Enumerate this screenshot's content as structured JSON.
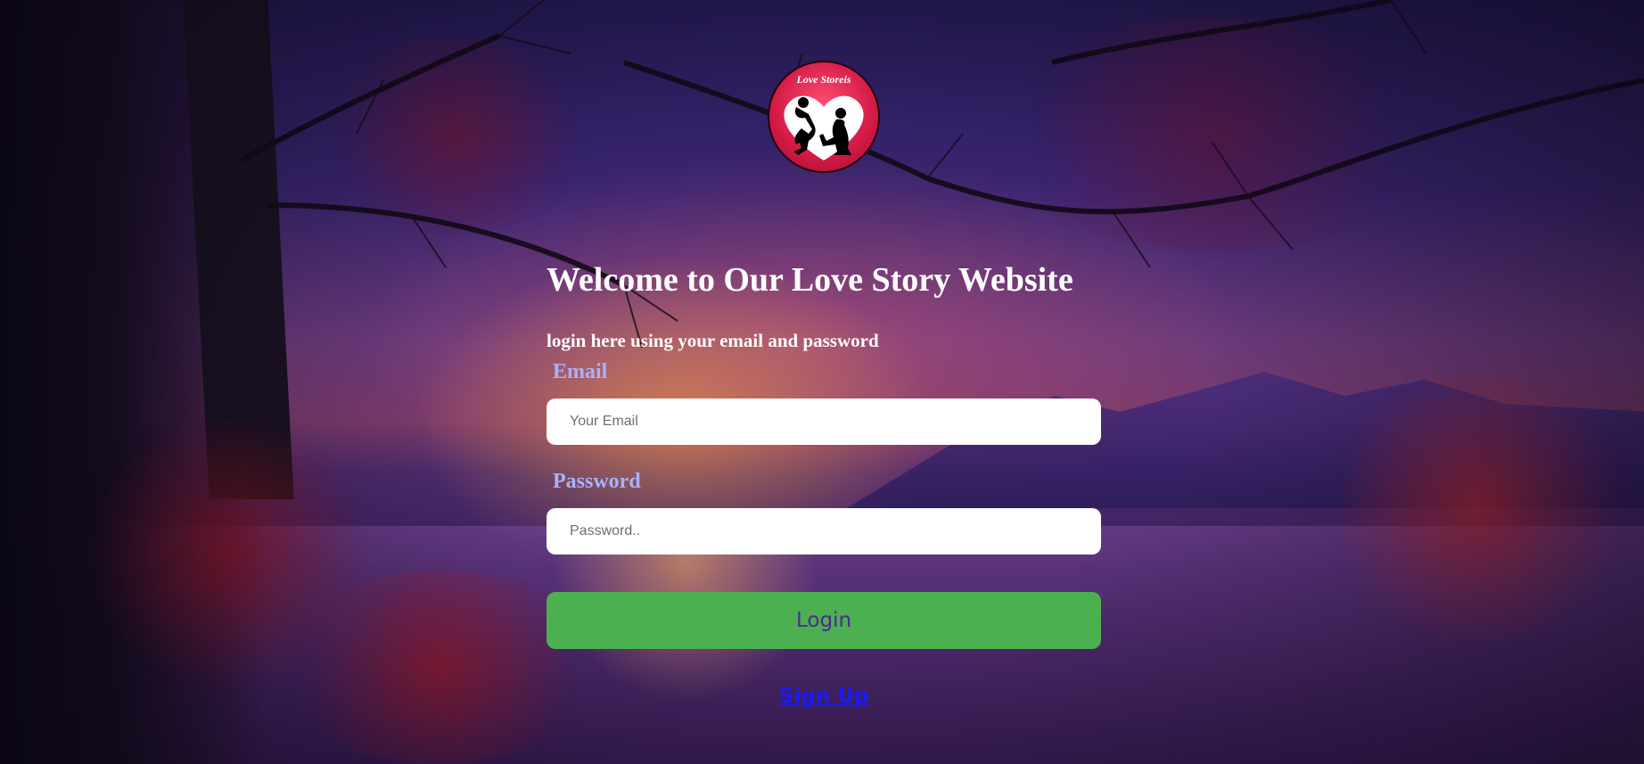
{
  "logo": {
    "text": "Love Storeis"
  },
  "header": {
    "title": "Welcome to Our Love Story Website",
    "subtitle": "login here using your email and password"
  },
  "form": {
    "email_label": "Email",
    "email_placeholder": "Your Email",
    "email_value": "",
    "password_label": "Password",
    "password_placeholder": "Password..",
    "password_value": "",
    "login_label": "Login",
    "signup_label": "Sign Up"
  },
  "colors": {
    "label": "#a7b2ff",
    "button": "#4caf50",
    "button_text": "#4a2a9a",
    "link": "#1a1aff",
    "logo_red": "#d21a44"
  }
}
